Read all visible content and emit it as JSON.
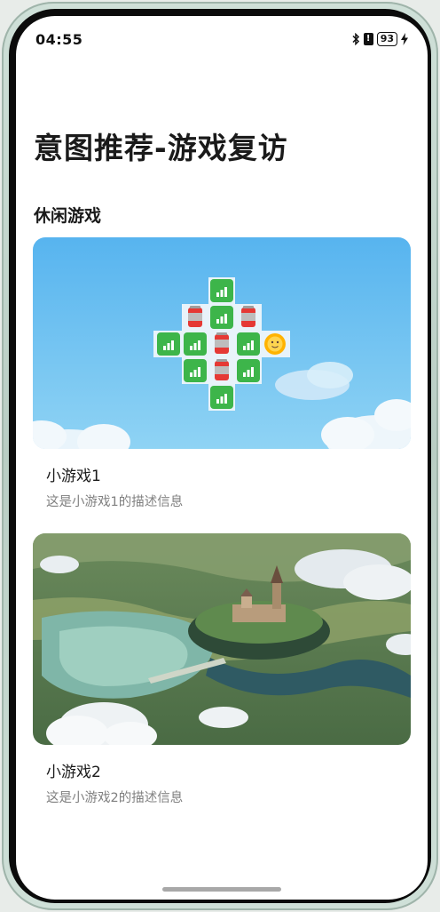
{
  "status_bar": {
    "time": "04:55",
    "battery": "93"
  },
  "page": {
    "title": "意图推荐-游戏复访"
  },
  "section": {
    "title": "休闲游戏"
  },
  "games": [
    {
      "name": "小游戏1",
      "description": "这是小游戏1的描述信息"
    },
    {
      "name": "小游戏2",
      "description": "这是小游戏2的描述信息"
    }
  ],
  "icons": [
    "bluetooth-icon",
    "alert-icon",
    "battery-icon",
    "charging-icon",
    "signal-tile-icon",
    "battery-can-icon",
    "sun-icon",
    "cloud-icon",
    "castle-icon"
  ],
  "colors": {
    "sky_top": "#57b4ef",
    "sky_bottom": "#8fd3f4",
    "tile_green": "#3db54a",
    "tile_red": "#e53935"
  }
}
